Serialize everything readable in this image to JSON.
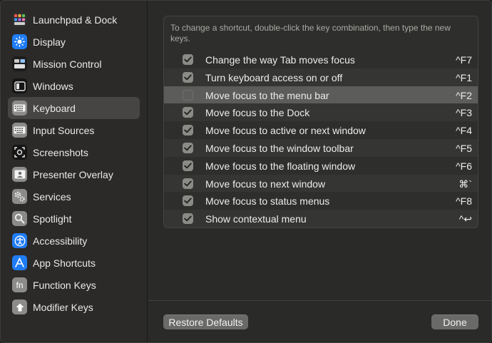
{
  "sidebar": {
    "items": [
      {
        "label": "Launchpad & Dock",
        "icon": "launchpad-dock-icon",
        "color": "#2a2a2a"
      },
      {
        "label": "Display",
        "icon": "display-icon",
        "color": "#1f7cf5"
      },
      {
        "label": "Mission Control",
        "icon": "mission-control-icon",
        "color": "#2a2a2a"
      },
      {
        "label": "Windows",
        "icon": "windows-icon",
        "color": "#1c1c1c"
      },
      {
        "label": "Keyboard",
        "icon": "keyboard-icon",
        "color": "#8b8b89"
      },
      {
        "label": "Input Sources",
        "icon": "input-sources-icon",
        "color": "#8b8b89"
      },
      {
        "label": "Screenshots",
        "icon": "screenshots-icon",
        "color": "#1c1c1c"
      },
      {
        "label": "Presenter Overlay",
        "icon": "presenter-overlay-icon",
        "color": "#8b8b89"
      },
      {
        "label": "Services",
        "icon": "services-icon",
        "color": "#8b8b89"
      },
      {
        "label": "Spotlight",
        "icon": "spotlight-icon",
        "color": "#8b8b89"
      },
      {
        "label": "Accessibility",
        "icon": "accessibility-icon",
        "color": "#1f7cf5"
      },
      {
        "label": "App Shortcuts",
        "icon": "app-shortcuts-icon",
        "color": "#1f7cf5"
      },
      {
        "label": "Function Keys",
        "icon": "function-keys-icon",
        "color": "#8b8b89"
      },
      {
        "label": "Modifier Keys",
        "icon": "modifier-keys-icon",
        "color": "#8b8b89"
      }
    ],
    "selected": "Keyboard"
  },
  "main": {
    "help_text": "To change a shortcut, double-click the key combination, then type the new keys.",
    "fn_icon_text": "fn",
    "shortcuts": [
      {
        "label": "Change the way Tab moves focus",
        "key": "^F7",
        "checked": true
      },
      {
        "label": "Turn keyboard access on or off",
        "key": "^F1",
        "checked": true
      },
      {
        "label": "Move focus to the menu bar",
        "key": "^F2",
        "checked": false
      },
      {
        "label": "Move focus to the Dock",
        "key": "^F3",
        "checked": true
      },
      {
        "label": "Move focus to active or next window",
        "key": "^F4",
        "checked": true
      },
      {
        "label": "Move focus to the window toolbar",
        "key": "^F5",
        "checked": true
      },
      {
        "label": "Move focus to the floating window",
        "key": "^F6",
        "checked": true
      },
      {
        "label": "Move focus to next window",
        "key": "⌘`",
        "checked": true
      },
      {
        "label": "Move focus to status menus",
        "key": "^F8",
        "checked": true
      },
      {
        "label": "Show contextual menu",
        "key": "^↩",
        "checked": true
      }
    ],
    "restore_label": "Restore Defaults",
    "done_label": "Done"
  }
}
